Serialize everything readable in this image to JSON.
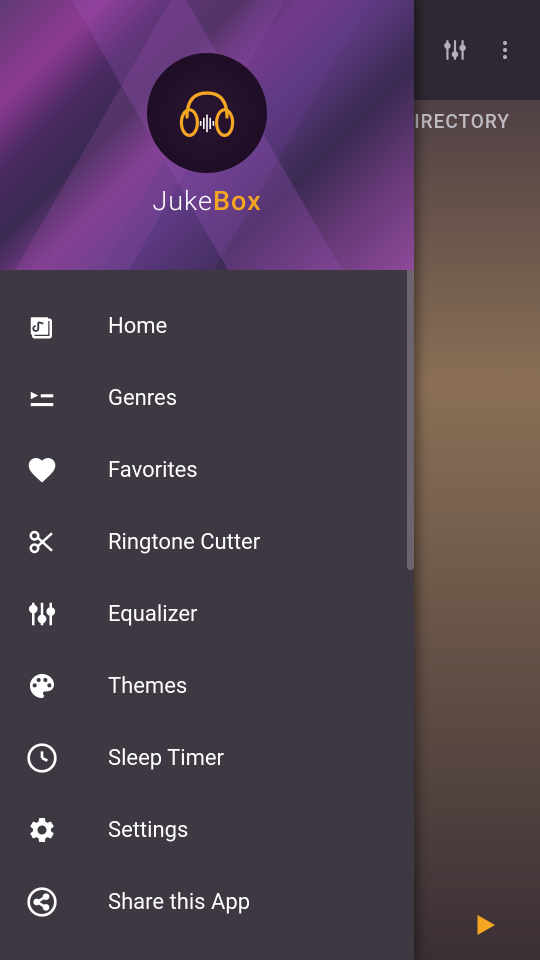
{
  "app": {
    "name_part1": "Juke",
    "name_part2": "Box"
  },
  "bg": {
    "tab_directory": "DIRECTORY"
  },
  "menu": {
    "items": [
      {
        "label": "Home",
        "icon": "home-icon"
      },
      {
        "label": "Genres",
        "icon": "genres-icon"
      },
      {
        "label": "Favorites",
        "icon": "heart-icon"
      },
      {
        "label": "Ringtone Cutter",
        "icon": "scissors-icon"
      },
      {
        "label": "Equalizer",
        "icon": "equalizer-icon"
      },
      {
        "label": "Themes",
        "icon": "palette-icon"
      },
      {
        "label": "Sleep Timer",
        "icon": "clock-icon"
      },
      {
        "label": "Settings",
        "icon": "gear-icon"
      },
      {
        "label": "Share this App",
        "icon": "share-icon"
      }
    ]
  },
  "colors": {
    "accent": "#f5a623",
    "drawer_bg": "#3e3843",
    "text": "#ffffff",
    "muted": "#b4b0b9"
  }
}
